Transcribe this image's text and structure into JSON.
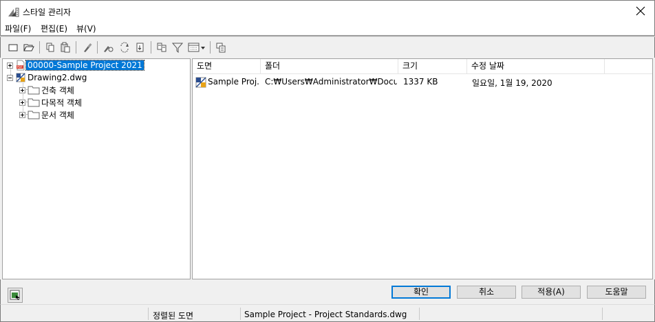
{
  "window": {
    "title": "스타일 관리자"
  },
  "menu": {
    "items": [
      "파일(F)",
      "편집(E)",
      "뷰(V)"
    ]
  },
  "tree": {
    "nodes": [
      {
        "label": "00000-Sample Project 2021",
        "selected": true
      },
      {
        "label": "Drawing2.dwg"
      },
      {
        "label": "건축 객체"
      },
      {
        "label": "다목적 객체"
      },
      {
        "label": "문서 객체"
      }
    ]
  },
  "list": {
    "columns": [
      "도면",
      "폴더",
      "크기",
      "수정 날짜"
    ],
    "rows": [
      {
        "drawing": "Sample Proj...",
        "folder": "C:₩Users₩Administrator₩Docum...",
        "size": "1337 KB",
        "modified": "일요일, 1월 19, 2020"
      }
    ]
  },
  "buttons": {
    "ok": "확인",
    "cancel": "취소",
    "apply": "적용(A)",
    "help": "도움말"
  },
  "status": {
    "label": "정렬된 도면",
    "value": "Sample Project - Project Standards.dwg"
  },
  "colors": {
    "selection": "#0078d7",
    "border": "#a0a0a0"
  }
}
